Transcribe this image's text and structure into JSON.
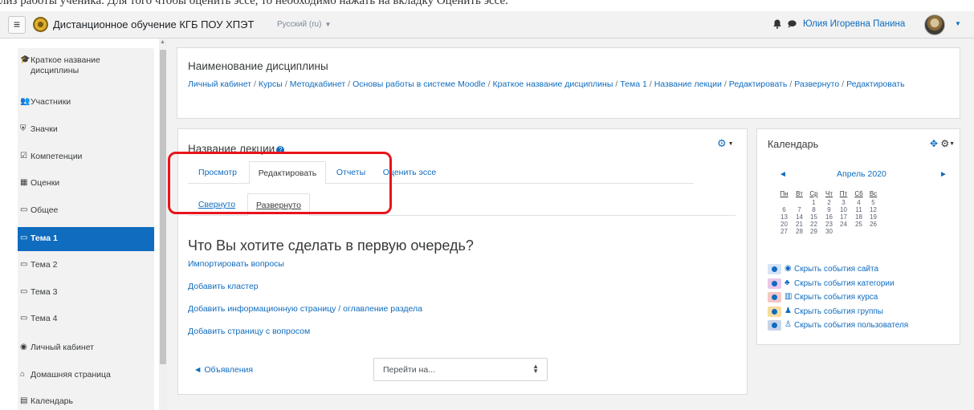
{
  "navbar": {
    "site_name": "Дистанционное обучение КГБ ПОУ ХПЭТ",
    "language": "Русский (ru)",
    "user_name": "Юлия Игоревна Панина",
    "doc_text": "лиз работы ученика. Для того чтобы оценить эссе, то необходимо нажать на вкладку Оценить эссе."
  },
  "sidebar": {
    "items": [
      {
        "label": "Краткое название\nдисциплины",
        "icon": "graduation-cap-icon"
      },
      {
        "label": "Участники",
        "icon": "users-icon"
      },
      {
        "label": "Значки",
        "icon": "shield-icon"
      },
      {
        "label": "Компетенции",
        "icon": "check-square-icon"
      },
      {
        "label": "Оценки",
        "icon": "table-icon"
      },
      {
        "label": "Общее",
        "icon": "folder-icon"
      },
      {
        "label": "Тема 1",
        "icon": "folder-icon",
        "active": true
      },
      {
        "label": "Тема 2",
        "icon": "folder-icon"
      },
      {
        "label": "Тема 3",
        "icon": "folder-icon"
      },
      {
        "label": "Тема 4",
        "icon": "folder-icon"
      },
      {
        "label": "Личный кабинет",
        "icon": "dashboard-icon"
      },
      {
        "label": "Домашняя страница",
        "icon": "home-icon"
      },
      {
        "label": "Календарь",
        "icon": "calendar-icon"
      }
    ]
  },
  "header": {
    "title": "Наименование дисциплины",
    "breadcrumb": [
      "Личный кабинет",
      "Курсы",
      "Методкабинет",
      "Основы работы в системе Moodle",
      "Краткое название дисциплины",
      "Тема 1",
      "Название лекции",
      "Редактировать",
      "Развернуто",
      "Редактировать"
    ]
  },
  "lesson": {
    "title": "Название лекции",
    "tabs": [
      "Просмотр",
      "Редактировать",
      "Отчеты",
      "Оценить эссе"
    ],
    "active_tab": "Редактировать",
    "subtabs": [
      "Свернуто",
      "Развернуто"
    ],
    "active_subtab": "Развернуто",
    "question": "Что Вы хотите сделать в первую очередь?",
    "actions": [
      "Импортировать вопросы",
      "Добавить кластер",
      "Добавить информационную страницу / оглавление раздела",
      "Добавить страницу с вопросом"
    ],
    "prev_link": "Объявления",
    "jump_placeholder": "Перейти на..."
  },
  "calendar": {
    "title": "Календарь",
    "month": "Апрель 2020",
    "weekdays": [
      "Пн",
      "Вт",
      "Ср",
      "Чт",
      "Пт",
      "Сб",
      "Вс"
    ],
    "weeks": [
      [
        "",
        "",
        "1",
        "2",
        "3",
        "4",
        "5"
      ],
      [
        "6",
        "7",
        "8",
        "9",
        "10",
        "11",
        "12"
      ],
      [
        "13",
        "14",
        "15",
        "16",
        "17",
        "18",
        "19"
      ],
      [
        "20",
        "21",
        "22",
        "23",
        "24",
        "25",
        "26"
      ],
      [
        "27",
        "28",
        "29",
        "30",
        "",
        "",
        ""
      ]
    ],
    "legend": [
      {
        "label": "Скрыть события сайта",
        "color": "#d6e4f7",
        "icon": "globe-icon"
      },
      {
        "label": "Скрыть события категории",
        "color": "#e8c8e8",
        "icon": "cubes-icon"
      },
      {
        "label": "Скрыть события курса",
        "color": "#f5c6c6",
        "icon": "university-icon"
      },
      {
        "label": "Скрыть события группы",
        "color": "#f7dc9e",
        "icon": "group-icon"
      },
      {
        "label": "Скрыть события пользователя",
        "color": "#c8d4e8",
        "icon": "user-icon"
      }
    ]
  },
  "colors": {
    "accent": "#0f6cbf",
    "highlight": "#e8141c",
    "page_bg": "#f2f2f2"
  }
}
